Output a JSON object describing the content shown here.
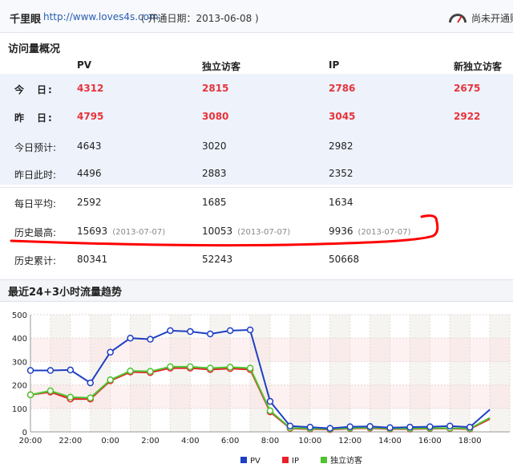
{
  "topbar": {
    "site_name": "千里眼",
    "site_url": "http://www.loves4s.com",
    "open_date": "( 开通日期：2013-06-08 )",
    "status_label": "尚未开通财",
    "gauge_icon": "speedometer-icon"
  },
  "overview": {
    "title": "访问量概况",
    "headers": [
      "PV",
      "独立访客",
      "IP",
      "新独立访客"
    ],
    "rows": [
      {
        "label": "今　日:",
        "values": [
          "4312",
          "2815",
          "2786",
          "2675"
        ],
        "sub": [
          "",
          "",
          ""
        ]
      },
      {
        "label": "昨　日:",
        "values": [
          "4795",
          "3080",
          "3045",
          "2922"
        ],
        "sub": [
          "",
          "",
          ""
        ]
      },
      {
        "label": "今日预计:",
        "values": [
          "4643",
          "3020",
          "2982",
          ""
        ],
        "sub": [
          "",
          "",
          ""
        ]
      },
      {
        "label": "昨日此时:",
        "values": [
          "4496",
          "2883",
          "2352",
          ""
        ],
        "sub": [
          "",
          "",
          ""
        ]
      },
      {
        "label": "每日平均:",
        "values": [
          "2592",
          "1685",
          "1634",
          ""
        ],
        "sub": [
          "",
          "",
          ""
        ]
      },
      {
        "label": "历史最高:",
        "values": [
          "15693",
          "10053",
          "9936",
          ""
        ],
        "sub": [
          "(2013-07-07)",
          "(2013-07-07)",
          "(2013-07-07)"
        ]
      },
      {
        "label": "历史累计:",
        "values": [
          "80341",
          "52243",
          "50668",
          ""
        ],
        "sub": [
          "",
          "",
          ""
        ]
      }
    ],
    "highlight_color": "#e8333a",
    "annotation_color": "#ff0000"
  },
  "chart_section": {
    "title": "最近24+3小时流量趋势"
  },
  "chart_data": {
    "type": "line",
    "x": [
      "20:00",
      "21:00",
      "22:00",
      "23:00",
      "0:00",
      "1:00",
      "2:00",
      "3:00",
      "4:00",
      "5:00",
      "6:00",
      "7:00",
      "8:00",
      "9:00",
      "10:00",
      "11:00",
      "12:00",
      "13:00",
      "14:00",
      "15:00",
      "16:00",
      "17:00",
      "18:00",
      "19:00",
      "20:00"
    ],
    "x_tick_labels": [
      "20:00",
      "22:00",
      "0:00",
      "2:00",
      "4:00",
      "6:00",
      "8:00",
      "10:00",
      "12:00",
      "14:00",
      "16:00",
      "18:00"
    ],
    "ylim": [
      0,
      500
    ],
    "y_ticks": [
      0,
      100,
      200,
      300,
      400,
      500
    ],
    "grid": true,
    "legend_position": "bottom",
    "series": [
      {
        "name": "PV",
        "color": "#1f3fc4",
        "values": [
          262,
          262,
          264,
          209,
          340,
          400,
          395,
          432,
          428,
          418,
          432,
          435,
          130,
          25,
          20,
          15,
          22,
          23,
          18,
          20,
          22,
          25,
          20,
          95
        ]
      },
      {
        "name": "IP",
        "color": "#e8202a",
        "values": [
          158,
          170,
          140,
          140,
          218,
          255,
          253,
          272,
          272,
          266,
          270,
          266,
          85,
          15,
          12,
          10,
          14,
          16,
          12,
          12,
          14,
          14,
          12,
          55
        ]
      },
      {
        "name": "独立访客",
        "color": "#4fc430",
        "values": [
          158,
          175,
          148,
          145,
          222,
          260,
          258,
          278,
          278,
          272,
          276,
          272,
          90,
          17,
          14,
          12,
          16,
          18,
          14,
          14,
          16,
          16,
          14,
          60
        ]
      }
    ]
  }
}
